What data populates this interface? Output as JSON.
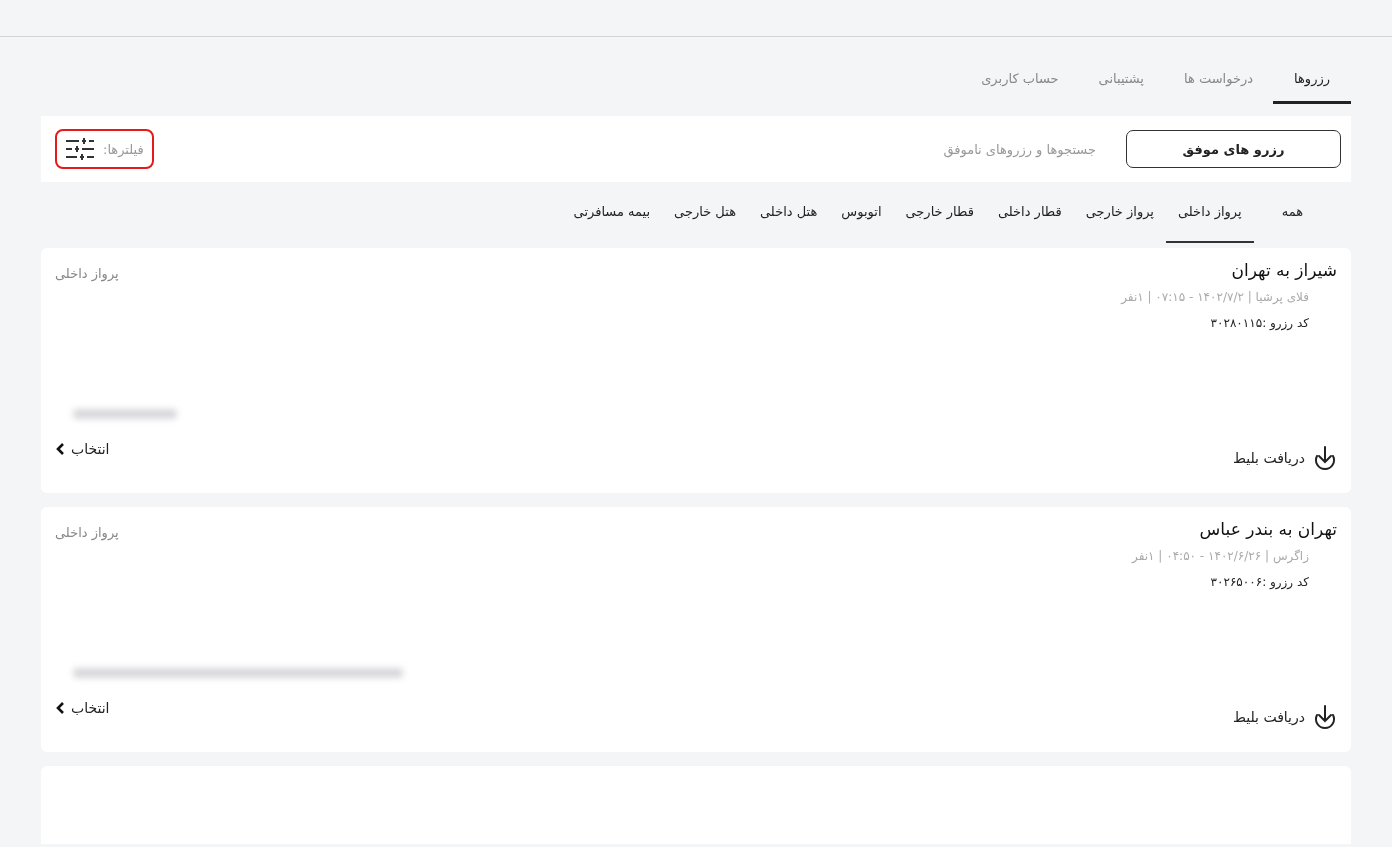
{
  "main_tabs": [
    {
      "label": "رزروها",
      "selected": true
    },
    {
      "label": "درخواست ها",
      "selected": false
    },
    {
      "label": "پشتیبانی",
      "selected": false
    },
    {
      "label": "حساب کاربری",
      "selected": false
    }
  ],
  "toolbar": {
    "segments": [
      {
        "label": "رزرو های موفق",
        "selected": true
      },
      {
        "label": "جستجوها و رزروهای ناموفق",
        "selected": false
      }
    ],
    "filter": {
      "label": "فیلترها:",
      "highlighted": true
    }
  },
  "category_tabs": [
    {
      "label": "همه",
      "selected": false
    },
    {
      "label": "پرواز داخلی",
      "selected": true
    },
    {
      "label": "پرواز خارجی",
      "selected": false
    },
    {
      "label": "قطار داخلی",
      "selected": false
    },
    {
      "label": "قطار خارجی",
      "selected": false
    },
    {
      "label": "اتوبوس",
      "selected": false
    },
    {
      "label": "هتل داخلی",
      "selected": false
    },
    {
      "label": "هتل خارجی",
      "selected": false
    },
    {
      "label": "بیمه مسافرتی",
      "selected": false
    }
  ],
  "bookings": [
    {
      "route": "شیراز به تهران",
      "meta": "فلای پرشیا | ۱۴۰۲/۷/۲ - ۰۷:۱۵ | ۱نفر",
      "code": "کد رزرو :۳۰۲۸۰۱۱۵",
      "kind": "booking",
      "category": "پرواز داخلی",
      "name_blurred": true,
      "download": "دریافت بلیط",
      "select": "انتخاب"
    },
    {
      "route": "تهران به بندر عباس",
      "meta": "زاگرس | ۱۴۰۲/۶/۲۶ - ۰۴:۵۰ | ۱نفر",
      "code": "کد رزرو :۳۰۲۶۵۰۰۶",
      "kind": "booking",
      "category": "پرواز داخلی",
      "name_blurred": true,
      "download": "دریافت بلیط",
      "select": "انتخاب"
    },
    {
      "kind": "empty"
    }
  ]
}
